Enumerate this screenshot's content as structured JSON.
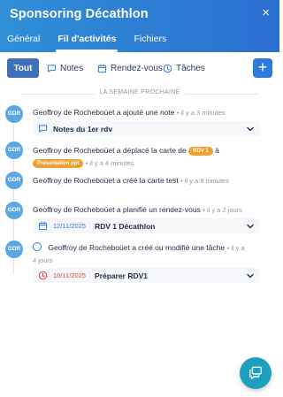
{
  "header": {
    "title": "Sponsoring Décathlon",
    "close": "×",
    "tabs": [
      {
        "label": "Général"
      },
      {
        "label": "Fil d'activités"
      },
      {
        "label": "Fichiers"
      }
    ]
  },
  "filters": {
    "all": "Tout",
    "notes": "Notes",
    "meetings": "Rendez-vous",
    "tasks": "Tâches",
    "add": "+"
  },
  "section_label": "LA SEMAINE PROCHAINE",
  "activities": [
    {
      "avatar": "GDR",
      "text": "Geoffroy de Rocheboüet a ajouté une note",
      "time": "• il y a 3 minutes",
      "card": {
        "name": "Notes du 1er rdv"
      }
    },
    {
      "avatar": "GDR",
      "text_prefix": "Geoffroy de Rocheboüet a déplacé la carte de",
      "badge1": "RDV 1",
      "text_suffix": "à",
      "badge2": "Présentation ppt",
      "time": "• il y a 4 minutes"
    },
    {
      "avatar": "GDR",
      "text": "Geoffroy de Rocheboüet a créé la carte test",
      "time": "• il y a 9 minutes"
    },
    {
      "avatar": "GDR",
      "text": "Geoffroy de Rocheboüet a planifié un rendez-vous",
      "time": "• il y a 2 jours",
      "card": {
        "date": "12/11/2025",
        "name": "RDV 1 Décathlon"
      }
    },
    {
      "avatar": "GDR",
      "text": "Geoffroy de Rocheboüet a créé ou modifié une tâche",
      "time_line1": "• il y a",
      "time_line2": "4 jours",
      "card": {
        "date": "10/11/2025",
        "name": "Préparer RDV1"
      }
    }
  ],
  "colors": {
    "header": "#2b7fd4",
    "accent": "#2f7bdc",
    "badge_orange": "#f0a030",
    "overdue": "#e0453a",
    "chat": "#1f9fbe"
  }
}
